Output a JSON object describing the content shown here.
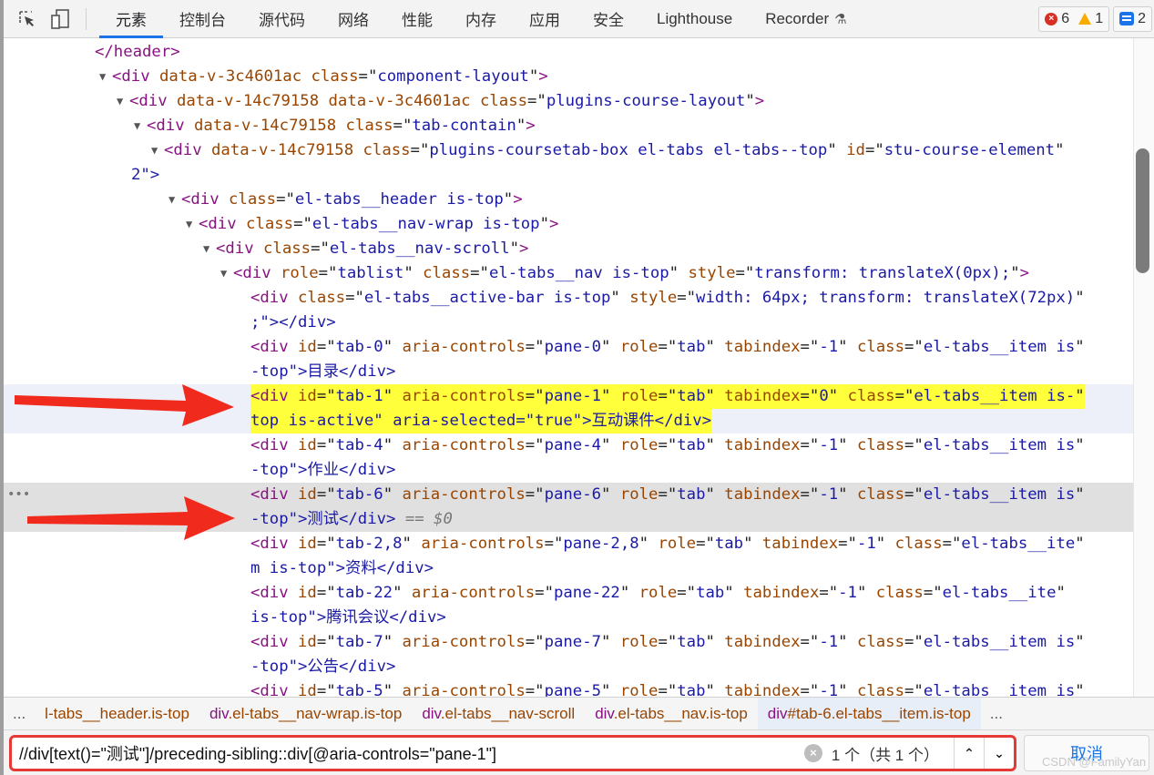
{
  "toolbar": {
    "tools": [
      {
        "name": "inspect-element",
        "icon": "cursor-select-icon"
      },
      {
        "name": "device-toolbar",
        "icon": "device-mode-icon"
      }
    ],
    "tabs": [
      {
        "label": "元素",
        "active": true
      },
      {
        "label": "控制台"
      },
      {
        "label": "源代码"
      },
      {
        "label": "网络"
      },
      {
        "label": "性能"
      },
      {
        "label": "内存"
      },
      {
        "label": "应用"
      },
      {
        "label": "安全"
      },
      {
        "label": "Lighthouse"
      },
      {
        "label": "Recorder",
        "icon": "flask-icon"
      }
    ],
    "errors_count": "6",
    "warnings_count": "1",
    "messages_count": "2"
  },
  "dom_lines": [
    {
      "indent": 0,
      "text": "</header>"
    },
    {
      "indent": 1,
      "caret": true,
      "tag": "div",
      "attrs": [
        [
          "data-v-3c4601ac",
          null
        ],
        [
          "class",
          "component-layout"
        ]
      ],
      "close": ">"
    },
    {
      "indent": 2,
      "caret": true,
      "tag": "div",
      "attrs": [
        [
          "data-v-14c79158",
          null
        ],
        [
          "data-v-3c4601ac",
          null
        ],
        [
          "class",
          "plugins-course-layout"
        ]
      ],
      "close": ">"
    },
    {
      "indent": 3,
      "caret": true,
      "tag": "div",
      "attrs": [
        [
          "data-v-14c79158",
          null
        ],
        [
          "class",
          "tab-contain"
        ]
      ],
      "close": ">"
    },
    {
      "indent": 4,
      "caret": true,
      "tag": "div",
      "attrs": [
        [
          "data-v-14c79158",
          null
        ],
        [
          "class",
          "plugins-coursetab-box el-tabs el-tabs--top"
        ],
        [
          "id",
          "stu-course-element"
        ]
      ],
      "wrap": "2\">"
    },
    {
      "indent": 5,
      "caret": true,
      "tag": "div",
      "attrs": [
        [
          "class",
          "el-tabs__header is-top"
        ]
      ],
      "close": ">"
    },
    {
      "indent": 6,
      "caret": true,
      "tag": "div",
      "attrs": [
        [
          "class",
          "el-tabs__nav-wrap is-top"
        ]
      ],
      "close": ">"
    },
    {
      "indent": 7,
      "caret": true,
      "tag": "div",
      "attrs": [
        [
          "class",
          "el-tabs__nav-scroll"
        ]
      ],
      "close": ">"
    },
    {
      "indent": 8,
      "caret": true,
      "tag": "div",
      "attrs": [
        [
          "role",
          "tablist"
        ],
        [
          "class",
          "el-tabs__nav is-top"
        ],
        [
          "style",
          "transform: translateX(0px);"
        ]
      ],
      "close": ">"
    },
    {
      "indent": 9,
      "tag": "div",
      "attrs": [
        [
          "class",
          "el-tabs__active-bar is-top"
        ],
        [
          "style",
          "width: 64px; transform: translateX(72px)"
        ]
      ],
      "wrap": ";\"></div>"
    },
    {
      "indent": 9,
      "tag": "div",
      "attrs": [
        [
          "id",
          "tab-0"
        ],
        [
          "aria-controls",
          "pane-0"
        ],
        [
          "role",
          "tab"
        ],
        [
          "tabindex",
          "-1"
        ],
        [
          "class",
          "el-tabs__item is"
        ]
      ],
      "wrap": "-top\">目录</div>"
    },
    {
      "indent": 9,
      "highlight": true,
      "tag": "div",
      "attrs": [
        [
          "id",
          "tab-1"
        ],
        [
          "aria-controls",
          "pane-1"
        ],
        [
          "role",
          "tab"
        ],
        [
          "tabindex",
          "0"
        ],
        [
          "class",
          "el-tabs__item is-"
        ]
      ],
      "wrap": "top is-active\" aria-selected=\"true\">互动课件</div>"
    },
    {
      "indent": 9,
      "tag": "div",
      "attrs": [
        [
          "id",
          "tab-4"
        ],
        [
          "aria-controls",
          "pane-4"
        ],
        [
          "role",
          "tab"
        ],
        [
          "tabindex",
          "-1"
        ],
        [
          "class",
          "el-tabs__item is"
        ]
      ],
      "wrap": "-top\">作业</div>"
    },
    {
      "indent": 9,
      "selected": true,
      "tag": "div",
      "attrs": [
        [
          "id",
          "tab-6"
        ],
        [
          "aria-controls",
          "pane-6"
        ],
        [
          "role",
          "tab"
        ],
        [
          "tabindex",
          "-1"
        ],
        [
          "class",
          "el-tabs__item is"
        ]
      ],
      "wrap": "-top\">测试</div>",
      "console_ref": "== $0"
    },
    {
      "indent": 9,
      "tag": "div",
      "attrs": [
        [
          "id",
          "tab-2,8"
        ],
        [
          "aria-controls",
          "pane-2,8"
        ],
        [
          "role",
          "tab"
        ],
        [
          "tabindex",
          "-1"
        ],
        [
          "class",
          "el-tabs__ite"
        ]
      ],
      "wrap": "m is-top\">资料</div>"
    },
    {
      "indent": 9,
      "tag": "div",
      "attrs": [
        [
          "id",
          "tab-22"
        ],
        [
          "aria-controls",
          "pane-22"
        ],
        [
          "role",
          "tab"
        ],
        [
          "tabindex",
          "-1"
        ],
        [
          "class",
          "el-tabs__ite"
        ]
      ],
      "wrap": "is-top\">腾讯会议</div>"
    },
    {
      "indent": 9,
      "tag": "div",
      "attrs": [
        [
          "id",
          "tab-7"
        ],
        [
          "aria-controls",
          "pane-7"
        ],
        [
          "role",
          "tab"
        ],
        [
          "tabindex",
          "-1"
        ],
        [
          "class",
          "el-tabs__item is"
        ]
      ],
      "wrap": "-top\">公告</div>"
    },
    {
      "indent": 9,
      "tag": "div",
      "attrs": [
        [
          "id",
          "tab-5"
        ],
        [
          "aria-controls",
          "pane-5"
        ],
        [
          "role",
          "tab"
        ],
        [
          "tabindex",
          "-1"
        ],
        [
          "class",
          "el-tabs__item is"
        ]
      ]
    }
  ],
  "breadcrumbs": {
    "leading": "...",
    "items": [
      {
        "tag": "",
        "rest": "l-tabs__header.is-top"
      },
      {
        "tag": "div",
        "rest": ".el-tabs__nav-wrap.is-top"
      },
      {
        "tag": "div",
        "rest": ".el-tabs__nav-scroll"
      },
      {
        "tag": "div",
        "rest": ".el-tabs__nav.is-top"
      },
      {
        "tag": "div",
        "rest": "#tab-6.el-tabs__item.is-top",
        "active": true
      }
    ],
    "trailing": "..."
  },
  "search": {
    "query": "//div[text()=\"测试\"]/preceding-sibling::div[@aria-controls=\"pane-1\"]",
    "match_count": "1 个（共 1 个）",
    "cancel_label": "取消"
  },
  "watermark": "CSDN @FamilyYan",
  "colors": {
    "accent": "#1a73e8",
    "highlight_yellow": "#ffff3c",
    "annotation_red": "#e53935",
    "tag": "#881280",
    "attr_name": "#994500",
    "attr_value": "#1a1aa6"
  }
}
